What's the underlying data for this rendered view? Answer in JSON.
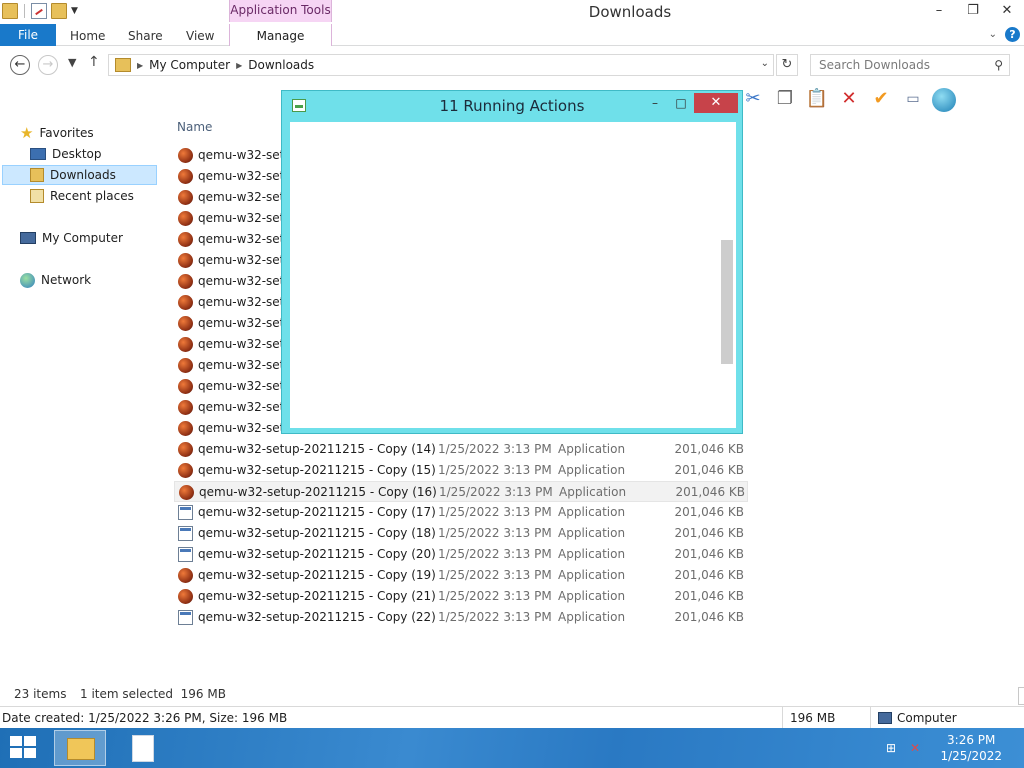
{
  "window": {
    "title": "Downloads",
    "contextual_tab": "Application Tools",
    "controls": {
      "minimize": "–",
      "restore": "❐",
      "close": "✕"
    }
  },
  "ribbon": {
    "file": "File",
    "tabs": [
      "Home",
      "Share",
      "View"
    ],
    "manage": "Manage",
    "help": "?"
  },
  "address": {
    "crumbs": [
      "My Computer",
      "Downloads"
    ],
    "search_placeholder": "Search Downloads"
  },
  "nav": {
    "favorites": "Favorites",
    "desktop": "Desktop",
    "downloads": "Downloads",
    "recent": "Recent places",
    "computer": "My Computer",
    "network": "Network"
  },
  "list": {
    "col_name": "Name",
    "hidden_rows": [
      "qemu-w32-setu",
      "qemu-w32-setu",
      "qemu-w32-setu",
      "qemu-w32-setu",
      "qemu-w32-setu",
      "qemu-w32-setu",
      "qemu-w32-setu",
      "qemu-w32-setu",
      "qemu-w32-setu",
      "qemu-w32-setu",
      "qemu-w32-setu",
      "qemu-w32-setu",
      "qemu-w32-setu",
      "qemu-w32-setu"
    ],
    "rows": [
      {
        "name": "qemu-w32-setup-20211215 - Copy (14)",
        "date": "1/25/2022 3:13 PM",
        "type": "Application",
        "size": "201,046 KB",
        "icon": "qemu"
      },
      {
        "name": "qemu-w32-setup-20211215 - Copy (15)",
        "date": "1/25/2022 3:13 PM",
        "type": "Application",
        "size": "201,046 KB",
        "icon": "qemu"
      },
      {
        "name": "qemu-w32-setup-20211215 - Copy (16)",
        "date": "1/25/2022 3:13 PM",
        "type": "Application",
        "size": "201,046 KB",
        "icon": "qemu"
      },
      {
        "name": "qemu-w32-setup-20211215 - Copy (17)",
        "date": "1/25/2022 3:13 PM",
        "type": "Application",
        "size": "201,046 KB",
        "icon": "app"
      },
      {
        "name": "qemu-w32-setup-20211215 - Copy (18)",
        "date": "1/25/2022 3:13 PM",
        "type": "Application",
        "size": "201,046 KB",
        "icon": "app"
      },
      {
        "name": "qemu-w32-setup-20211215 - Copy (20)",
        "date": "1/25/2022 3:13 PM",
        "type": "Application",
        "size": "201,046 KB",
        "icon": "app"
      },
      {
        "name": "qemu-w32-setup-20211215 - Copy (19)",
        "date": "1/25/2022 3:13 PM",
        "type": "Application",
        "size": "201,046 KB",
        "icon": "qemu"
      },
      {
        "name": "qemu-w32-setup-20211215 - Copy (21)",
        "date": "1/25/2022 3:13 PM",
        "type": "Application",
        "size": "201,046 KB",
        "icon": "qemu"
      },
      {
        "name": "qemu-w32-setup-20211215 - Copy (22)",
        "date": "1/25/2022 3:13 PM",
        "type": "Application",
        "size": "201,046 KB",
        "icon": "app"
      }
    ]
  },
  "status": {
    "items": "23 items",
    "selected": "1 item selected  196 MB",
    "details": "Date created: 1/25/2022 3:26 PM, Size: 196 MB",
    "size": "196 MB",
    "location": "Computer"
  },
  "dialog": {
    "title": "11 Running Actions",
    "controls": {
      "minimize": "–",
      "maximize": "□",
      "close": "✕"
    }
  },
  "taskbar": {
    "time": "3:26 PM",
    "date": "1/25/2022"
  }
}
